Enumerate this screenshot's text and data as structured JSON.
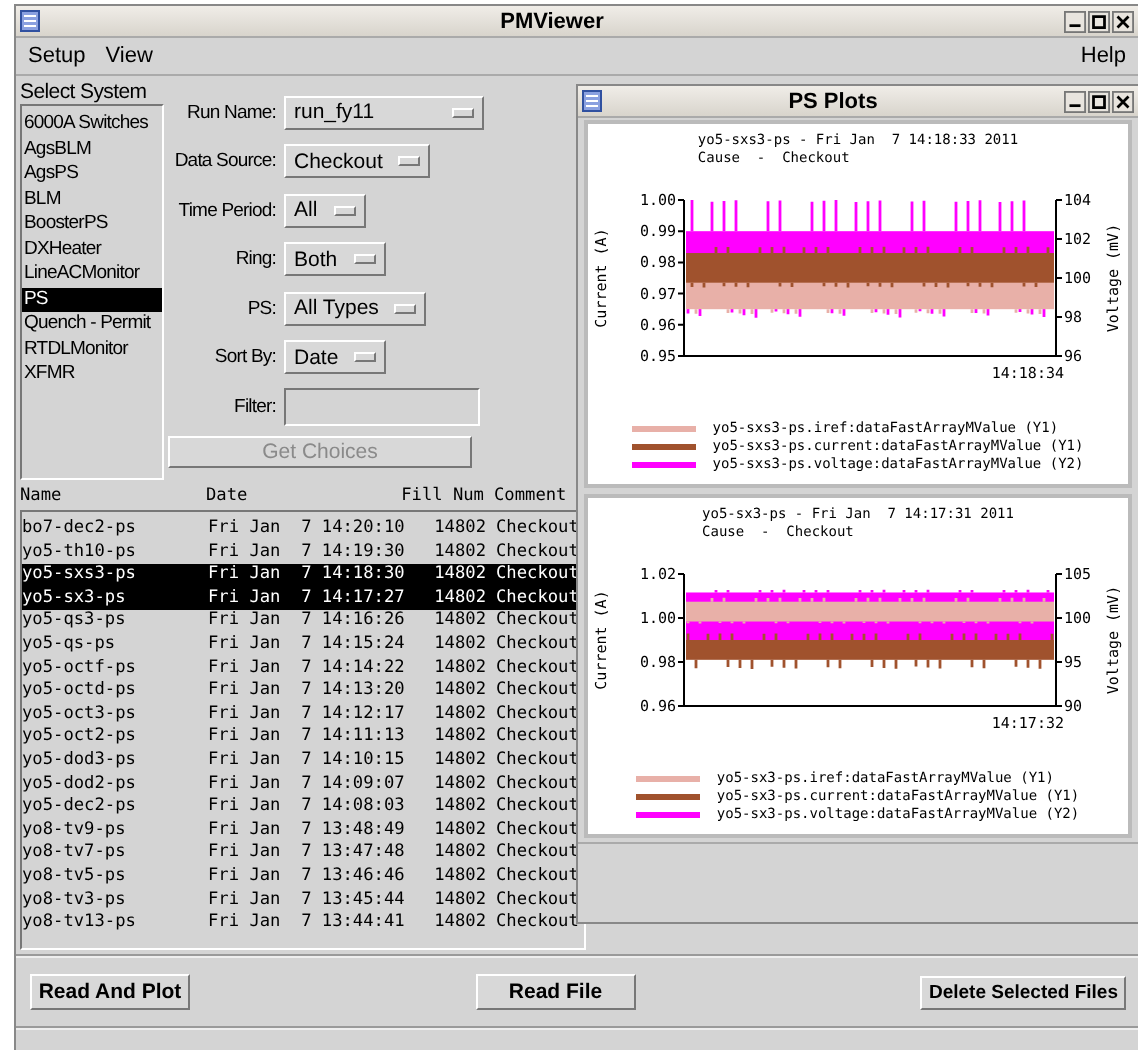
{
  "window": {
    "title": "PMViewer"
  },
  "menus": [
    "Setup",
    "View"
  ],
  "help_menu": "Help",
  "system_list": {
    "title": "Select System",
    "items": [
      {
        "label": "6000A Switches",
        "selected": false
      },
      {
        "label": "AgsBLM",
        "selected": false
      },
      {
        "label": "AgsPS",
        "selected": false
      },
      {
        "label": "BLM",
        "selected": false
      },
      {
        "label": "BoosterPS",
        "selected": false
      },
      {
        "label": "DXHeater",
        "selected": false
      },
      {
        "label": "LineACMonitor",
        "selected": false
      },
      {
        "label": "PS",
        "selected": true
      },
      {
        "label": "Quench - Permit",
        "selected": false
      },
      {
        "label": "RTDLMonitor",
        "selected": false
      },
      {
        "label": "XFMR",
        "selected": false
      }
    ]
  },
  "form": {
    "fields": [
      {
        "label": "Run Name:",
        "kind": "dropdown",
        "value": "run_fy11"
      },
      {
        "label": "Data Source:",
        "kind": "dropdown",
        "value": "Checkout"
      },
      {
        "label": "Time Period:",
        "kind": "dropdown",
        "value": "All"
      },
      {
        "label": "Ring:",
        "kind": "dropdown",
        "value": "Both"
      },
      {
        "label": "PS:",
        "kind": "dropdown",
        "value": "All Types"
      },
      {
        "label": "Sort By:",
        "kind": "dropdown",
        "value": "Date"
      },
      {
        "label": "Filter:",
        "kind": "text"
      }
    ],
    "get_choices_button": {
      "label": "Get Choices",
      "disabled": true
    }
  },
  "table": {
    "columns": [
      "Name",
      "Date",
      "Fill Num",
      "Comment"
    ],
    "rows": [
      {
        "cells": [
          "bo7-dec2-ps",
          "Fri Jan  7 14:20:10",
          "14802",
          "Checkout"
        ],
        "selected": false
      },
      {
        "cells": [
          "yo5-th10-ps",
          "Fri Jan  7 14:19:30",
          "14802",
          "Checkout"
        ],
        "selected": false
      },
      {
        "cells": [
          "yo5-sxs3-ps",
          "Fri Jan  7 14:18:30",
          "14802",
          "Checkout"
        ],
        "selected": true
      },
      {
        "cells": [
          "yo5-sx3-ps",
          "Fri Jan  7 14:17:27",
          "14802",
          "Checkout"
        ],
        "selected": true
      },
      {
        "cells": [
          "yo5-qs3-ps",
          "Fri Jan  7 14:16:26",
          "14802",
          "Checkout"
        ],
        "selected": false
      },
      {
        "cells": [
          "yo5-qs-ps",
          "Fri Jan  7 14:15:24",
          "14802",
          "Checkout"
        ],
        "selected": false
      },
      {
        "cells": [
          "yo5-octf-ps",
          "Fri Jan  7 14:14:22",
          "14802",
          "Checkout"
        ],
        "selected": false
      },
      {
        "cells": [
          "yo5-octd-ps",
          "Fri Jan  7 14:13:20",
          "14802",
          "Checkout"
        ],
        "selected": false
      },
      {
        "cells": [
          "yo5-oct3-ps",
          "Fri Jan  7 14:12:17",
          "14802",
          "Checkout"
        ],
        "selected": false
      },
      {
        "cells": [
          "yo5-oct2-ps",
          "Fri Jan  7 14:11:13",
          "14802",
          "Checkout"
        ],
        "selected": false
      },
      {
        "cells": [
          "yo5-dod3-ps",
          "Fri Jan  7 14:10:15",
          "14802",
          "Checkout"
        ],
        "selected": false
      },
      {
        "cells": [
          "yo5-dod2-ps",
          "Fri Jan  7 14:09:07",
          "14802",
          "Checkout"
        ],
        "selected": false
      },
      {
        "cells": [
          "yo5-dec2-ps",
          "Fri Jan  7 14:08:03",
          "14802",
          "Checkout"
        ],
        "selected": false
      },
      {
        "cells": [
          "yo8-tv9-ps",
          "Fri Jan  7 13:48:49",
          "14802",
          "Checkout"
        ],
        "selected": false
      },
      {
        "cells": [
          "yo8-tv7-ps",
          "Fri Jan  7 13:47:48",
          "14802",
          "Checkout"
        ],
        "selected": false
      },
      {
        "cells": [
          "yo8-tv5-ps",
          "Fri Jan  7 13:46:46",
          "14802",
          "Checkout"
        ],
        "selected": false
      },
      {
        "cells": [
          "yo8-tv3-ps",
          "Fri Jan  7 13:45:44",
          "14802",
          "Checkout"
        ],
        "selected": false
      },
      {
        "cells": [
          "yo8-tv13-ps",
          "Fri Jan  7 13:44:41",
          "14802",
          "Checkout"
        ],
        "selected": false
      }
    ]
  },
  "buttons": [
    "Read And Plot",
    "Read File",
    "Delete Selected Files"
  ],
  "plot_window": {
    "title": "PS Plots",
    "plots": [
      {
        "title_lines": [
          "yo5-sxs3-ps - Fri Jan  7 14:18:33 2011",
          "Cause  -  Checkout"
        ],
        "left_axis_label": "Current (A)",
        "right_axis_label": "Voltage (mV)",
        "left_ticks": [
          "1.00",
          "0.99",
          "0.98",
          "0.97",
          "0.96",
          "0.95"
        ],
        "right_ticks": [
          "104",
          "102",
          "100",
          "98",
          "96"
        ],
        "x_tick": "14:18:34",
        "legend": [
          {
            "label": "yo5-sxs3-ps.iref:dataFastArrayMValue (Y1)",
            "color": "#e8b0a8"
          },
          {
            "label": "yo5-sxs3-ps.current:dataFastArrayMValue (Y1)",
            "color": "#a0522d"
          },
          {
            "label": "yo5-sxs3-ps.voltage:dataFastArrayMValue (Y2)",
            "color": "#ff00ff"
          }
        ]
      },
      {
        "title_lines": [
          "yo5-sx3-ps - Fri Jan  7 14:17:31 2011",
          "Cause  -  Checkout"
        ],
        "left_axis_label": "Current (A)",
        "right_axis_label": "Voltage (mV)",
        "left_ticks": [
          "1.02",
          "1.00",
          "0.98",
          "0.96"
        ],
        "right_ticks": [
          "105",
          "100",
          "95",
          "90"
        ],
        "x_tick": "14:17:32",
        "legend": [
          {
            "label": "yo5-sx3-ps.iref:dataFastArrayMValue (Y1)",
            "color": "#e8b0a8"
          },
          {
            "label": "yo5-sx3-ps.current:dataFastArrayMValue (Y1)",
            "color": "#a0522d"
          },
          {
            "label": "yo5-sx3-ps.voltage:dataFastArrayMValue (Y2)",
            "color": "#ff00ff"
          }
        ]
      }
    ]
  }
}
